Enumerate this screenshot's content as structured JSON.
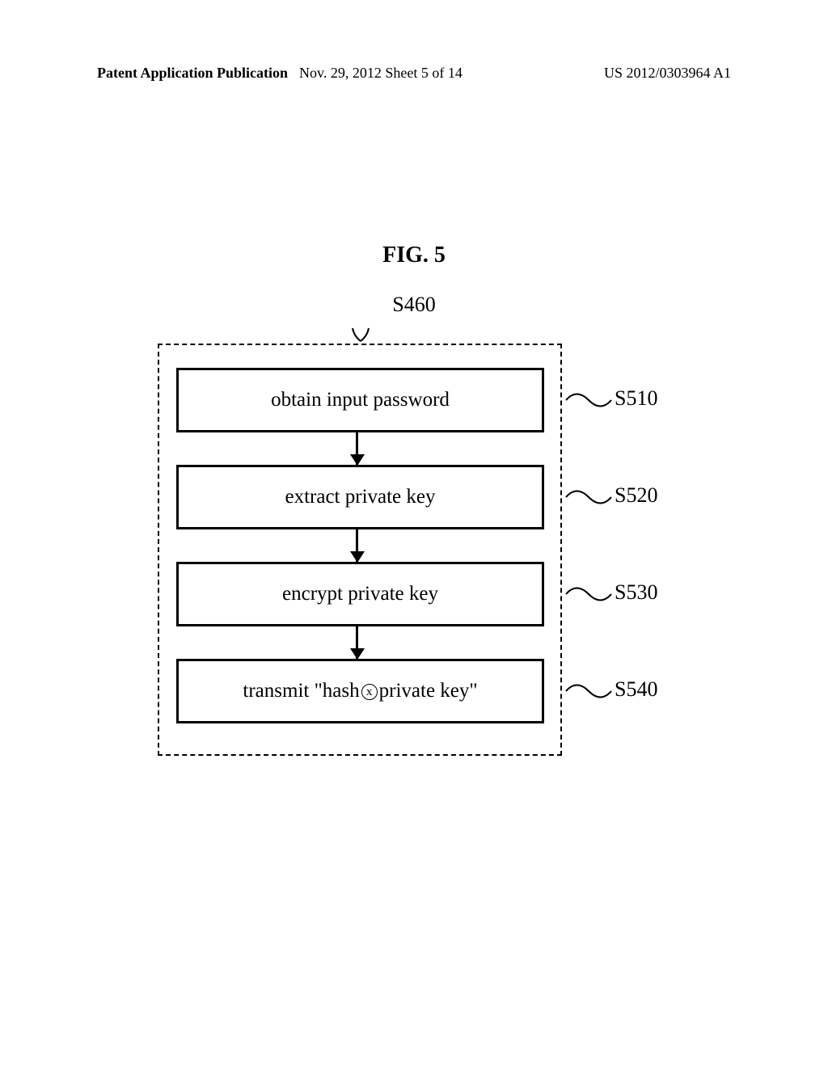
{
  "header": {
    "left": "Patent Application Publication",
    "center": "Nov. 29, 2012  Sheet 5 of 14",
    "right": "US 2012/0303964 A1"
  },
  "figure": {
    "title": "FIG. 5",
    "container_label": "S460"
  },
  "chart_data": {
    "type": "flowchart",
    "container": "S460",
    "steps": [
      {
        "id": "S510",
        "text": "obtain input password"
      },
      {
        "id": "S520",
        "text": "extract private key"
      },
      {
        "id": "S530",
        "text": "encrypt private key"
      },
      {
        "id": "S540",
        "text": "transmit \"hash⊗private key\""
      }
    ],
    "flow": [
      "S510",
      "S520",
      "S530",
      "S540"
    ]
  }
}
